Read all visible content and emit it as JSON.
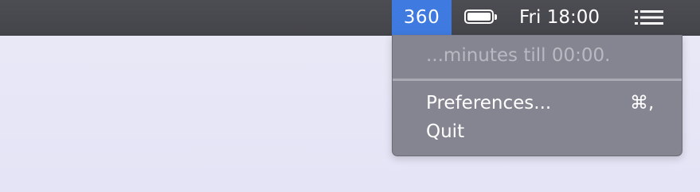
{
  "menubar": {
    "status_item": "360",
    "battery_icon": "battery-full-icon",
    "clock": "Fri 18:00",
    "menu_icon": "list-icon"
  },
  "dropdown": {
    "countdown_text": "...minutes till 00:00.",
    "items": [
      {
        "label": "Preferences...",
        "shortcut": "⌘,"
      },
      {
        "label": "Quit"
      }
    ]
  },
  "colors": {
    "menubar": "#48484f",
    "status_item_highlight": "#3e7ae0",
    "dropdown_bg": "#80818c",
    "disabled_text": "#b8b9c1",
    "desktop": "#e7e7f6"
  }
}
